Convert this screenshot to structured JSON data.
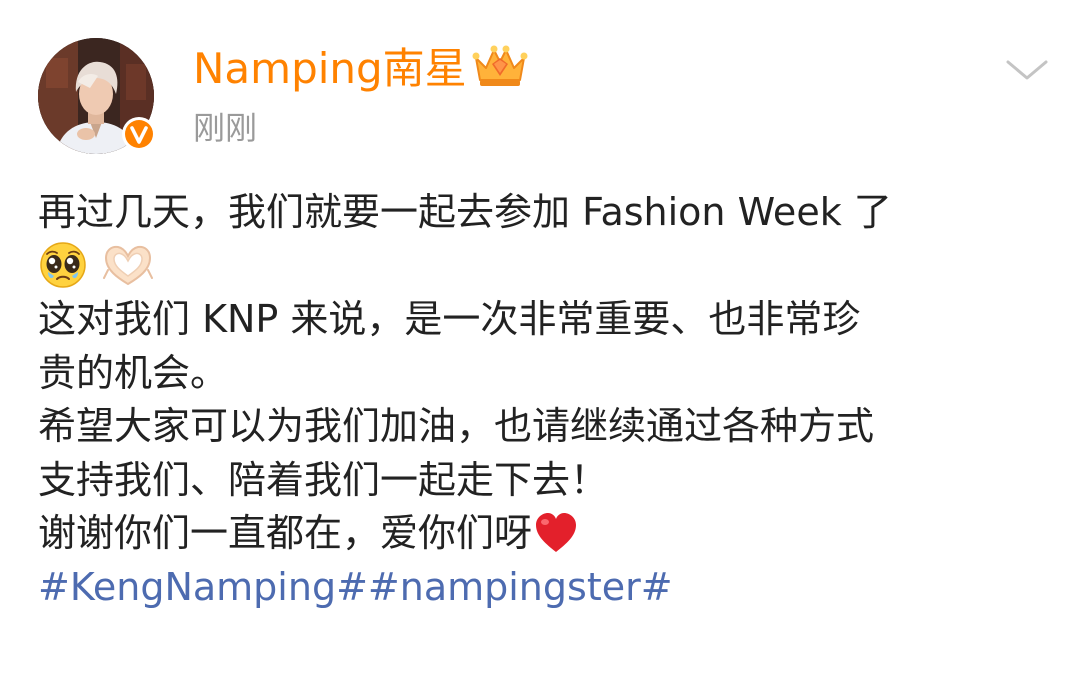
{
  "post": {
    "author": {
      "name": "Namping南星",
      "avatar_icon": "profile-photo",
      "verified_icon": "verified-v-badge",
      "badge_icon": "vip-crown-icon"
    },
    "timestamp": "刚刚",
    "more_icon": "chevron-down-icon",
    "content": {
      "line1": "再过几天，我们就要一起去参加 Fashion Week 了",
      "line2_emojis": [
        "pleading-face-emoji",
        "heart-hands-emoji"
      ],
      "line3": "这对我们 KNP 来说，是一次非常重要、也非常珍",
      "line4": "贵的机会。",
      "line5": "希望大家可以为我们加油，也请继续通过各种方式",
      "line6": "支持我们、陪着我们一起走下去！",
      "line7": "谢谢你们一直都在，爱你们呀",
      "line7_emoji": "red-heart-emoji"
    },
    "hashtags": [
      "#KengNamping#",
      "#nampingster#"
    ]
  },
  "colors": {
    "author_name": "#ff8200",
    "timestamp": "#9a9a9a",
    "body_text": "#222222",
    "hashtag": "#4d6bb0",
    "verified_badge": "#ff8200",
    "heart": "#e3202b"
  }
}
